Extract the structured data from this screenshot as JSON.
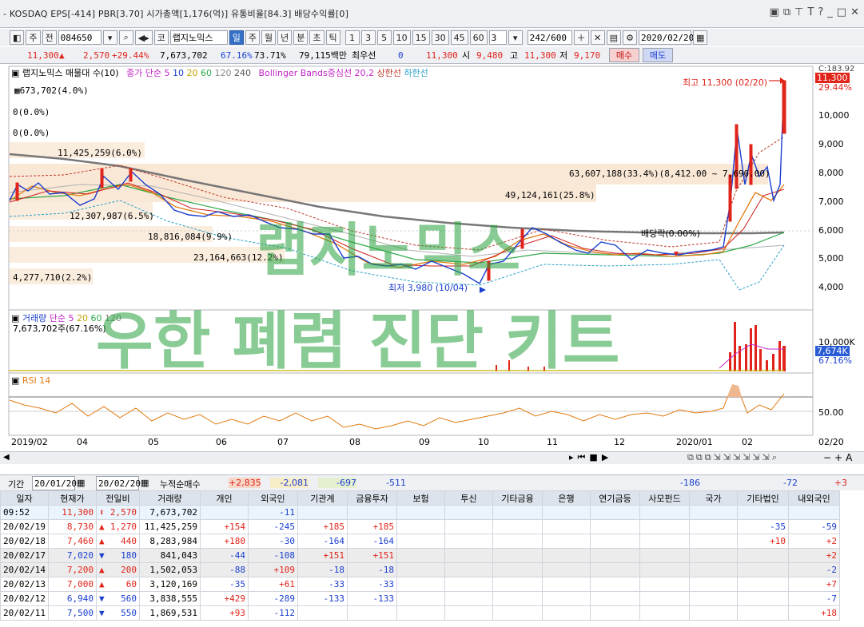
{
  "window_title": "- KOSDAQ EPS[-414] PBR[3.70] 시가총액[1,176(억)] 유통비율[84.3] 배당수익률[0]",
  "toolbar": {
    "mode": "주",
    "prev": "전",
    "code": "084650",
    "market": "코",
    "name": "랩지노믹스",
    "periods": [
      "일",
      "주",
      "월",
      "년",
      "분",
      "초",
      "틱"
    ],
    "period_selected": "일",
    "intervals": [
      "1",
      "3",
      "5",
      "10",
      "15",
      "30",
      "45",
      "60"
    ],
    "interval_value": "3",
    "count": "242/600",
    "date": "2020/02/20"
  },
  "quote": {
    "price": "11,300",
    "change": "2,570",
    "change_pct": "+29.44%",
    "volume": "7,673,702",
    "vol_ratio": "67.16%",
    "turnover": "73.71%",
    "amount": "79,115백만",
    "best_label": "최우선",
    "best_val": "0",
    "price2": "11,300",
    "open_label": "시",
    "open": "9,480",
    "high_label": "고",
    "high": "11,300",
    "low_label": "저",
    "low": "9,170",
    "buy": "매수",
    "sell": "매도"
  },
  "legend": {
    "main": "랩지노믹스 매물대 수(10)",
    "ma_label": "종가 단순 5",
    "ma": [
      "10",
      "20",
      "60",
      "120",
      "240"
    ],
    "bb": "Bollinger Bands중심선 20,2",
    "upper": "상한선",
    "lower": "하한선"
  },
  "price_axis": [
    "10,000",
    "9,000",
    "8,000",
    "7,000",
    "6,000",
    "5,000",
    "4,000"
  ],
  "price_axis_top": "C:183.92",
  "price_tag": "11,300",
  "price_tag_pct": "29.44%",
  "annotations": {
    "high_mark": "최고 11,300 (02/20)",
    "low_mark": "최저 3,980 (10/04)",
    "dividend": "배당락(0.00%)",
    "v1": "673,702(4.0%)",
    "v2": "0(0.0%)",
    "v3": "0(0.0%)",
    "v4": "11,425,259(6.0%)",
    "v5": "63,607,188(33.4%)(8,412.00 ~ 7,690.00)",
    "v6": "49,124,161(25.8%)",
    "v7": "12,307,987(6.5%)",
    "v8": "18,816,084(9.9%)",
    "v9": "23,164,663(12.2%)",
    "v10": "4,277,710(2.2%)"
  },
  "volume_panel": {
    "label": "거래량",
    "ma_label": "단순 5",
    "ma": [
      "20",
      "60",
      "120"
    ],
    "value": "7,673,702주(67.16%)",
    "axis": "10,000K",
    "tag": "7,674K",
    "tag_pct": "67.16%"
  },
  "rsi_panel": {
    "label": "RSI 14",
    "axis": "50.00"
  },
  "x_axis": [
    "2019/02",
    "04",
    "05",
    "06",
    "07",
    "08",
    "09",
    "10",
    "11",
    "12",
    "2020/01",
    "02",
    "02/20"
  ],
  "watermark": {
    "line1": "랩지노믹스",
    "line2": "우한 폐렴 진단 키트"
  },
  "period_bar": {
    "label": "기간",
    "from": "20/01/20",
    "to": "20/02/20",
    "sum_label": "누적순매수",
    "sums": [
      "+2,835",
      "-2,081",
      "-697",
      "-511",
      "",
      "",
      "",
      "",
      "",
      "-186",
      "",
      "-72",
      "+3"
    ]
  },
  "table": {
    "headers": [
      "일자",
      "현재가",
      "전일비",
      "거래량",
      "개인",
      "외국인",
      "기관계",
      "금융투자",
      "보험",
      "투신",
      "기타금융",
      "은행",
      "연기금등",
      "사모펀드",
      "국가",
      "기타법인",
      "내외국인"
    ],
    "rows": [
      {
        "date": "09:52",
        "price": "11,300",
        "dir": "up-arrow",
        "chg": "2,570",
        "vol": "7,673,702",
        "ind": "",
        "frn": "-11",
        "inst": "",
        "fin": "",
        "ins": "",
        "inv": "",
        "oth": "",
        "bank": "",
        "pen": "",
        "pe": "",
        "gov": "",
        "corp": "",
        "dom": ""
      },
      {
        "date": "20/02/19",
        "price": "8,730",
        "dir": "up",
        "chg": "1,270",
        "vol": "11,425,259",
        "ind": "+154",
        "frn": "-245",
        "inst": "+185",
        "fin": "+185",
        "ins": "",
        "inv": "",
        "oth": "",
        "bank": "",
        "pen": "",
        "pe": "",
        "gov": "",
        "corp": "-35",
        "dom": "-59"
      },
      {
        "date": "20/02/18",
        "price": "7,460",
        "dir": "up",
        "chg": "440",
        "vol": "8,283,984",
        "ind": "+180",
        "frn": "-30",
        "inst": "-164",
        "fin": "-164",
        "ins": "",
        "inv": "",
        "oth": "",
        "bank": "",
        "pen": "",
        "pe": "",
        "gov": "",
        "corp": "+10",
        "dom": "+2"
      },
      {
        "date": "20/02/17",
        "price": "7,020",
        "dir": "down",
        "chg": "180",
        "vol": "841,043",
        "ind": "-44",
        "frn": "-108",
        "inst": "+151",
        "fin": "+151",
        "ins": "",
        "inv": "",
        "oth": "",
        "bank": "",
        "pen": "",
        "pe": "",
        "gov": "",
        "corp": "",
        "dom": "+2"
      },
      {
        "date": "20/02/14",
        "price": "7,200",
        "dir": "up",
        "chg": "200",
        "vol": "1,502,053",
        "ind": "-88",
        "frn": "+109",
        "inst": "-18",
        "fin": "-18",
        "ins": "",
        "inv": "",
        "oth": "",
        "bank": "",
        "pen": "",
        "pe": "",
        "gov": "",
        "corp": "",
        "dom": "-2"
      },
      {
        "date": "20/02/13",
        "price": "7,000",
        "dir": "up",
        "chg": "60",
        "vol": "3,120,169",
        "ind": "-35",
        "frn": "+61",
        "inst": "-33",
        "fin": "-33",
        "ins": "",
        "inv": "",
        "oth": "",
        "bank": "",
        "pen": "",
        "pe": "",
        "gov": "",
        "corp": "",
        "dom": "+7"
      },
      {
        "date": "20/02/12",
        "price": "6,940",
        "dir": "down",
        "chg": "560",
        "vol": "3,838,555",
        "ind": "+429",
        "frn": "-289",
        "inst": "-133",
        "fin": "-133",
        "ins": "",
        "inv": "",
        "oth": "",
        "bank": "",
        "pen": "",
        "pe": "",
        "gov": "",
        "corp": "",
        "dom": "-7"
      },
      {
        "date": "20/02/11",
        "price": "7,500",
        "dir": "down",
        "chg": "550",
        "vol": "1,869,531",
        "ind": "+93",
        "frn": "-112",
        "inst": "",
        "fin": "",
        "ins": "",
        "inv": "",
        "oth": "",
        "bank": "",
        "pen": "",
        "pe": "",
        "gov": "",
        "corp": "",
        "dom": "+18"
      }
    ]
  },
  "colors": {
    "up": "#e0241a",
    "down": "#1a3ecf",
    "header": "#dde3ec",
    "accent": "#3470c8",
    "band": "#f6d6b6"
  }
}
